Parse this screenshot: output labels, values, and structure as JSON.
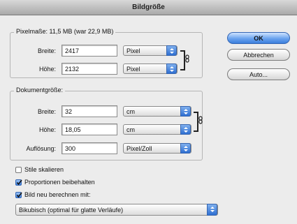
{
  "window": {
    "title": "Bildgröße"
  },
  "pixel_dims": {
    "legend": "Pixelmaße: 11,5 MB (war 22,9 MB)",
    "width_label": "Breite:",
    "width_value": "2417",
    "width_unit": "Pixel",
    "height_label": "Höhe:",
    "height_value": "2132",
    "height_unit": "Pixel"
  },
  "doc_size": {
    "legend": "Dokumentgröße:",
    "width_label": "Breite:",
    "width_value": "32",
    "width_unit": "cm",
    "height_label": "Höhe:",
    "height_value": "18,05",
    "height_unit": "cm",
    "res_label": "Auflösung:",
    "res_value": "300",
    "res_unit": "Pixel/Zoll"
  },
  "buttons": {
    "ok": "OK",
    "cancel": "Abbrechen",
    "auto": "Auto..."
  },
  "options": {
    "scale_styles": {
      "label": "Stile skalieren",
      "checked": false
    },
    "constrain": {
      "label": "Proportionen beibehalten",
      "checked": true
    },
    "resample": {
      "label": "Bild neu berechnen mit:",
      "checked": true
    }
  },
  "resample_method": "Bikubisch (optimal für glatte Verläufe)",
  "colors": {
    "accent": "#3b7fdc",
    "window_bg": "#ececec"
  }
}
